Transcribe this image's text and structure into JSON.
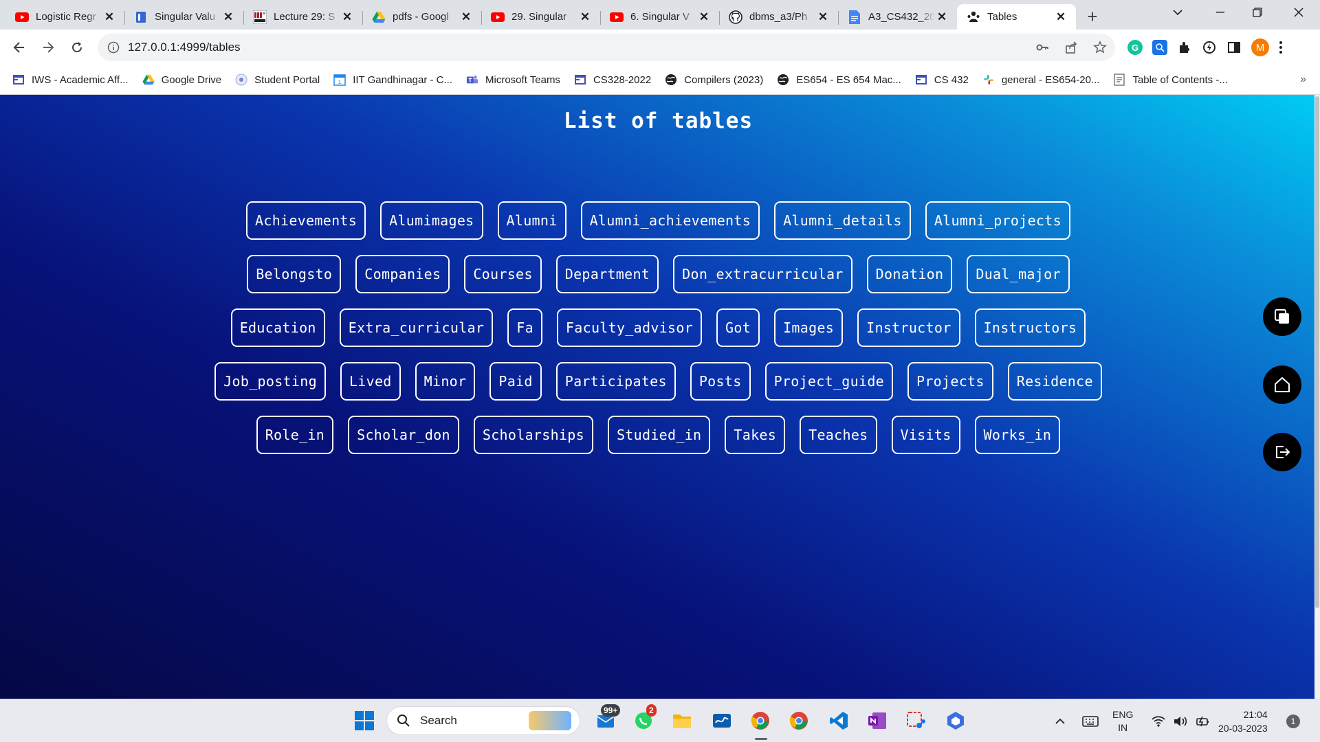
{
  "browser": {
    "tabs": [
      {
        "title": "Logistic Regr",
        "icon": "youtube-icon",
        "active": false
      },
      {
        "title": "Singular Valu",
        "icon": "doc-icon",
        "active": false
      },
      {
        "title": "Lecture 29: S",
        "icon": "mit-ocw-icon",
        "active": false
      },
      {
        "title": "pdfs - Googl",
        "icon": "google-drive-icon",
        "active": false
      },
      {
        "title": "29. Singular",
        "icon": "youtube-icon",
        "active": false
      },
      {
        "title": "6. Singular V",
        "icon": "youtube-icon",
        "active": false
      },
      {
        "title": "dbms_a3/Ph",
        "icon": "github-icon",
        "active": false
      },
      {
        "title": "A3_CS432_20",
        "icon": "google-docs-icon",
        "active": false
      },
      {
        "title": "Tables",
        "icon": "people-icon",
        "active": true
      }
    ],
    "url": "127.0.0.1:4999/tables",
    "profile_initial": "M",
    "bookmarks": [
      {
        "label": "IWS - Academic Aff...",
        "icon": "window-icon"
      },
      {
        "label": "Google Drive",
        "icon": "google-drive-icon"
      },
      {
        "label": "Student Portal",
        "icon": "portal-icon"
      },
      {
        "label": "IIT Gandhinagar - C...",
        "icon": "calendar-icon"
      },
      {
        "label": "Microsoft Teams",
        "icon": "teams-icon"
      },
      {
        "label": "CS328-2022",
        "icon": "window-icon"
      },
      {
        "label": "Compilers (2023)",
        "icon": "globe-icon"
      },
      {
        "label": "ES654 - ES 654 Mac...",
        "icon": "globe-icon"
      },
      {
        "label": "CS 432",
        "icon": "window-icon"
      },
      {
        "label": "general - ES654-20...",
        "icon": "slack-icon"
      },
      {
        "label": "Table of Contents -...",
        "icon": "toc-icon"
      }
    ],
    "bookmarks_more": "»"
  },
  "page": {
    "title": "List of tables",
    "table_rows": [
      [
        "Achievements",
        "Alumimages",
        "Alumni",
        "Alumni_achievements",
        "Alumni_details",
        "Alumni_projects"
      ],
      [
        "Belongsto",
        "Companies",
        "Courses",
        "Department",
        "Don_extracurricular",
        "Donation",
        "Dual_major"
      ],
      [
        "Education",
        "Extra_curricular",
        "Fa",
        "Faculty_advisor",
        "Got",
        "Images",
        "Instructor",
        "Instructors"
      ],
      [
        "Job_posting",
        "Lived",
        "Minor",
        "Paid",
        "Participates",
        "Posts",
        "Project_guide",
        "Projects",
        "Residence"
      ],
      [
        "Role_in",
        "Scholar_don",
        "Scholarships",
        "Studied_in",
        "Takes",
        "Teaches",
        "Visits",
        "Works_in"
      ]
    ],
    "floating_buttons": [
      {
        "name": "copy-button",
        "icon": "copy-icon"
      },
      {
        "name": "home-button",
        "icon": "home-icon"
      },
      {
        "name": "logout-button",
        "icon": "logout-icon"
      }
    ]
  },
  "taskbar": {
    "search_label": "Search",
    "mail_badge": "99+",
    "whatsapp_badge": "2",
    "language": "ENG",
    "region": "IN",
    "time": "21:04",
    "date": "20-03-2023",
    "notification_count": "1"
  },
  "colors": {
    "gradient_dark": "#050845",
    "gradient_mid": "#0a36b0",
    "gradient_light": "#00ccf5",
    "button_border": "#ffffff",
    "fab": "#000000"
  }
}
